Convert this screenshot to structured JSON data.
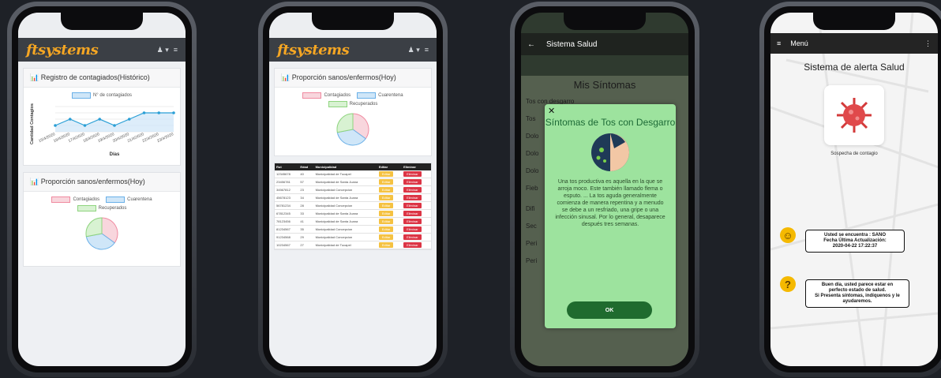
{
  "admin": {
    "logo": "ftsystems",
    "chart1_title": "Registro de contagiados(Histórico)",
    "chart1_legend": "N° de contagiados",
    "chart1_ylabel": "Cantidad Contagios",
    "chart1_xlabel": "Días",
    "chart1_xticks": [
      "15/4/2020",
      "16/4/2020",
      "17/4/2020",
      "18/4/2020",
      "19/4/2020",
      "20/4/2020",
      "21/4/2020",
      "22/4/2020",
      "23/4/2020"
    ],
    "chart2_title": "Proporción sanos/enfermos(Hoy)",
    "legend_contagiados": "Contagiados",
    "legend_cuarentena": "Cuarentena",
    "legend_recuperados": "Recuperados",
    "table_headers": [
      "Rut",
      "Edad",
      "Municipalidad",
      "Editar",
      "Eliminar"
    ],
    "edit_label": "Editar",
    "delete_label": "Eliminar",
    "rows": [
      [
        "12345678",
        "40",
        "Municipalidad de Tucapel"
      ],
      [
        "23456781",
        "57",
        "Municipalidad de Santa Juana"
      ],
      [
        "34567812",
        "23",
        "Municipalidad Concepcion"
      ],
      [
        "45678123",
        "34",
        "Municipalidad de Santa Juana"
      ],
      [
        "56781234",
        "28",
        "Municipalidad Concepcion"
      ],
      [
        "67812345",
        "33",
        "Municipalidad de Santa Juana"
      ],
      [
        "78123456",
        "41",
        "Municipalidad de Santa Juana"
      ],
      [
        "81234567",
        "35",
        "Municipalidad Concepcion"
      ],
      [
        "91234568",
        "29",
        "Municipalidad Concepcion"
      ],
      [
        "10234567",
        "27",
        "Municipalidad de Tucapel"
      ]
    ]
  },
  "chart_data": [
    {
      "type": "line",
      "title": "Registro de contagiados(Histórico)",
      "xlabel": "Días",
      "ylabel": "Cantidad Contagios",
      "x": [
        "15/4/2020",
        "16/4/2020",
        "17/4/2020",
        "18/4/2020",
        "19/4/2020",
        "20/4/2020",
        "21/4/2020",
        "22/4/2020",
        "23/4/2020"
      ],
      "series": [
        {
          "name": "N° de contagiados",
          "values": [
            2,
            3,
            2,
            3,
            2,
            3,
            4,
            4,
            4
          ]
        }
      ],
      "ylim": [
        1,
        5
      ]
    },
    {
      "type": "pie",
      "title": "Proporción sanos/enfermos(Hoy)",
      "categories": [
        "Contagiados",
        "Cuarentena",
        "Recuperados"
      ],
      "values": [
        35,
        37,
        28
      ],
      "colors": [
        "#f8d6dd",
        "#cfe6f8",
        "#d8f2d2"
      ]
    }
  ],
  "symptoms_app": {
    "app_title": "Sistema Salud",
    "page_title": "Mis Síntomas",
    "symptoms_visible": [
      "Tos con desgarro",
      "Tos",
      "Dolo",
      "Dolo",
      "Dolo",
      "Fieb",
      "Difi",
      "Sec",
      "Peri",
      "Peri"
    ],
    "modal_title": "Síntomas de Tos con Desgarro",
    "modal_text": "Una tos productiva es aquella en la que se arroja moco. Este también llamado flema o esputo. ... La tos aguda generalmente comienza de manera repentina y a menudo se debe a un resfriado, una gripe o una infección sinusal. Por lo general, desaparece después tres semanas.",
    "ok_label": "OK"
  },
  "alert_app": {
    "menu_label": "Menú",
    "title": "Sistema de alerta Salud",
    "virus_caption": "Sospecha de contagio",
    "status_text_1": "Usted se encuentra : SANO",
    "status_text_2": "Fecha Última Actualización:",
    "status_text_3": "2020-04-22 17:22:37",
    "advice_1": "Buen día, usted parece estar en",
    "advice_2": "perfecto estado de salud.",
    "advice_3": "Si Presenta síntomas, indíquenos y le",
    "advice_4": "ayudaremos."
  }
}
